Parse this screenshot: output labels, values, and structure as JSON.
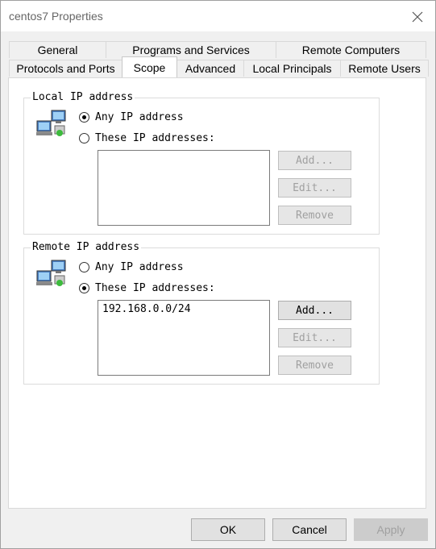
{
  "window": {
    "title": "centos7 Properties"
  },
  "tabs": {
    "row1": [
      "General",
      "Programs and Services",
      "Remote Computers"
    ],
    "row2": [
      "Protocols and Ports",
      "Scope",
      "Advanced",
      "Local Principals",
      "Remote Users"
    ],
    "active": "Scope"
  },
  "local": {
    "label": "Local IP address",
    "option_any": "Any IP address",
    "option_these": "These IP addresses:",
    "selected": "any",
    "addresses": [],
    "buttons": {
      "add": "Add...",
      "edit": "Edit...",
      "remove": "Remove"
    }
  },
  "remote": {
    "label": "Remote IP address",
    "option_any": "Any IP address",
    "option_these": "These IP addresses:",
    "selected": "these",
    "addresses": [
      "192.168.0.0/24"
    ],
    "buttons": {
      "add": "Add...",
      "edit": "Edit...",
      "remove": "Remove"
    }
  },
  "footer": {
    "ok": "OK",
    "cancel": "Cancel",
    "apply": "Apply"
  }
}
